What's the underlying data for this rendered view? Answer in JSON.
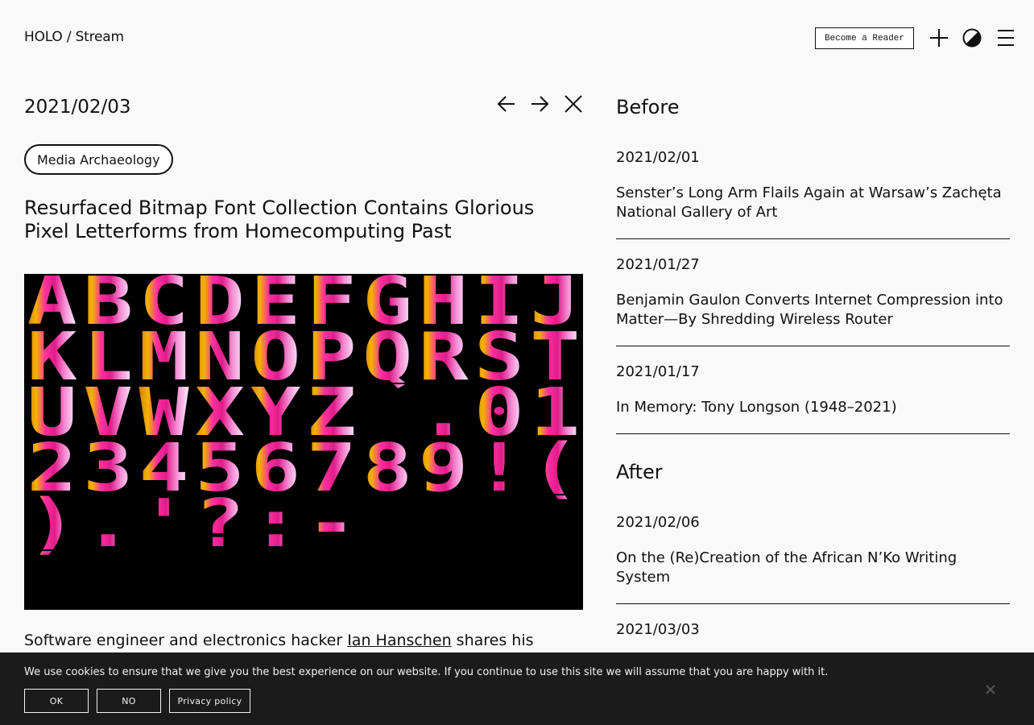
{
  "header": {
    "brand": "HOLO",
    "separator": " / ",
    "section": "Stream",
    "reader_button": "Become a Reader",
    "icons": [
      "plus-icon",
      "contrast-icon",
      "menu-icon"
    ]
  },
  "article": {
    "date": "2021/02/03",
    "nav_icons": [
      "arrow-left-icon",
      "arrow-right-icon",
      "close-icon"
    ],
    "tag": "Media Archaeology",
    "title": "Resurfaced Bitmap Font Collection Contains Glorious Pixel Letterforms from Homecomputing Past",
    "image_glyphs": [
      "ABCDEFGHIJ",
      "KLMNOPQRST",
      "UVWXYZ .01",
      "23456789!(",
      ").'?:-"
    ],
    "lead_before": "Software engineer and electronics hacker ",
    "lead_link": "Ian Hanschen",
    "lead_after": " shares his"
  },
  "sidebar": {
    "before_heading": "Before",
    "before": [
      {
        "date": "2021/02/01",
        "title": "Senster’s Long Arm Flails Again at Warsaw’s Zachęta National Gallery of Art"
      },
      {
        "date": "2021/01/27",
        "title": "Benjamin Gaulon Converts Internet Compression into Matter—By Shredding Wireless Router"
      },
      {
        "date": "2021/01/17",
        "title": "In Memory: Tony Longson (1948–2021)"
      }
    ],
    "after_heading": "After",
    "after": [
      {
        "date": "2021/02/06",
        "title": "On the (Re)Creation of the African N’Ko Writing System"
      },
      {
        "date": "2021/03/03",
        "title": ""
      }
    ]
  },
  "cookie": {
    "message": "We use cookies to ensure that we give you the best experience on our website. If you continue to use this site we will assume that you are happy with it.",
    "ok": "OK",
    "no": "NO",
    "privacy": "Privacy policy"
  },
  "colors": {
    "background": "#f9f9f9",
    "text": "#111111",
    "cookie_bar": "#1b1b1b",
    "gradient": [
      "#d97a08",
      "#f0a200",
      "#f2c000",
      "#ff2fa0",
      "#e01c8a",
      "#f58bd2",
      "#f2c6ee",
      "#ffffff"
    ]
  }
}
